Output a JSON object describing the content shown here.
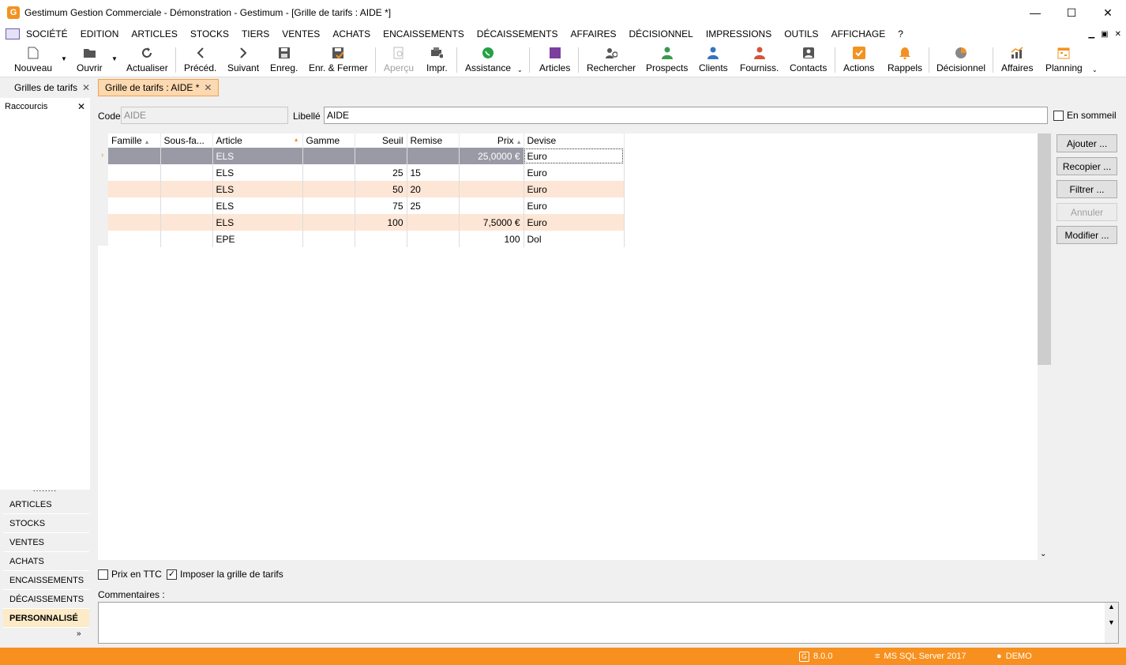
{
  "window": {
    "title": "Gestimum Gestion Commerciale - Démonstration - Gestimum - [Grille de tarifs : AIDE *]",
    "logo_letter": "G",
    "minimize": "—",
    "maximize": "☐",
    "close": "✕"
  },
  "menu": {
    "items": [
      "SOCIÉTÉ",
      "EDITION",
      "ARTICLES",
      "STOCKS",
      "TIERS",
      "VENTES",
      "ACHATS",
      "ENCAISSEMENTS",
      "DÉCAISSEMENTS",
      "AFFAIRES",
      "DÉCISIONNEL",
      "IMPRESSIONS",
      "OUTILS",
      "AFFICHAGE",
      "?"
    ],
    "right_controls": [
      "▁",
      "▣",
      "✕"
    ]
  },
  "toolbar": {
    "nouveau": "Nouveau",
    "ouvrir": "Ouvrir",
    "actualiser": "Actualiser",
    "preced": "Précéd.",
    "suivant": "Suivant",
    "enreg": "Enreg.",
    "enr_fermer": "Enr. & Fermer",
    "apercu": "Aperçu",
    "impr": "Impr.",
    "assistance": "Assistance",
    "articles": "Articles",
    "rechercher": "Rechercher",
    "prospects": "Prospects",
    "clients": "Clients",
    "fourniss": "Fourniss.",
    "contacts": "Contacts",
    "actions": "Actions",
    "rappels": "Rappels",
    "decisionnel": "Décisionnel",
    "affaires": "Affaires",
    "planning": "Planning"
  },
  "tabs": {
    "grilles": "Grilles de tarifs",
    "current": "Grille de tarifs : AIDE *",
    "close": "✕"
  },
  "sidebar": {
    "title": "Raccourcis",
    "close": "✕",
    "dots": "........",
    "items": [
      "ARTICLES",
      "STOCKS",
      "VENTES",
      "ACHATS",
      "ENCAISSEMENTS",
      "DÉCAISSEMENTS",
      "PERSONNALISÉ"
    ],
    "chevron": "»"
  },
  "form": {
    "code_label": "Code",
    "code_value": "AIDE",
    "libelle_label": "Libellé",
    "libelle_value": "AIDE",
    "sommeil_label": "En sommeil",
    "prix_ttc_label": "Prix en TTC",
    "imposer_label": "Imposer la grille de tarifs",
    "commentaires_label": "Commentaires :"
  },
  "grid": {
    "columns": [
      "Famille",
      "Sous-fa...",
      "Article",
      "Gamme",
      "Seuil",
      "Remise",
      "Prix",
      "Devise"
    ],
    "rows": [
      [
        "",
        "",
        "ELS",
        "",
        "",
        "",
        "25,0000 €",
        "Euro"
      ],
      [
        "",
        "",
        "ELS",
        "",
        "25",
        "15",
        "",
        "Euro"
      ],
      [
        "",
        "",
        "ELS",
        "",
        "50",
        "20",
        "",
        "Euro"
      ],
      [
        "",
        "",
        "ELS",
        "",
        "75",
        "25",
        "",
        "Euro"
      ],
      [
        "",
        "",
        "ELS",
        "",
        "100",
        "",
        "7,5000 €",
        "Euro"
      ],
      [
        "",
        "",
        "EPE",
        "",
        "",
        "",
        "100",
        "Dol"
      ]
    ],
    "row_marker": "›",
    "scroll_down": "⌄"
  },
  "buttons": {
    "ajouter": "Ajouter ...",
    "recopier": "Recopier ...",
    "filtrer": "Filtrer ...",
    "annuler": "Annuler",
    "modifier": "Modifier ..."
  },
  "status": {
    "version": "8.0.0",
    "database": "MS SQL Server 2017",
    "user": "DEMO"
  }
}
